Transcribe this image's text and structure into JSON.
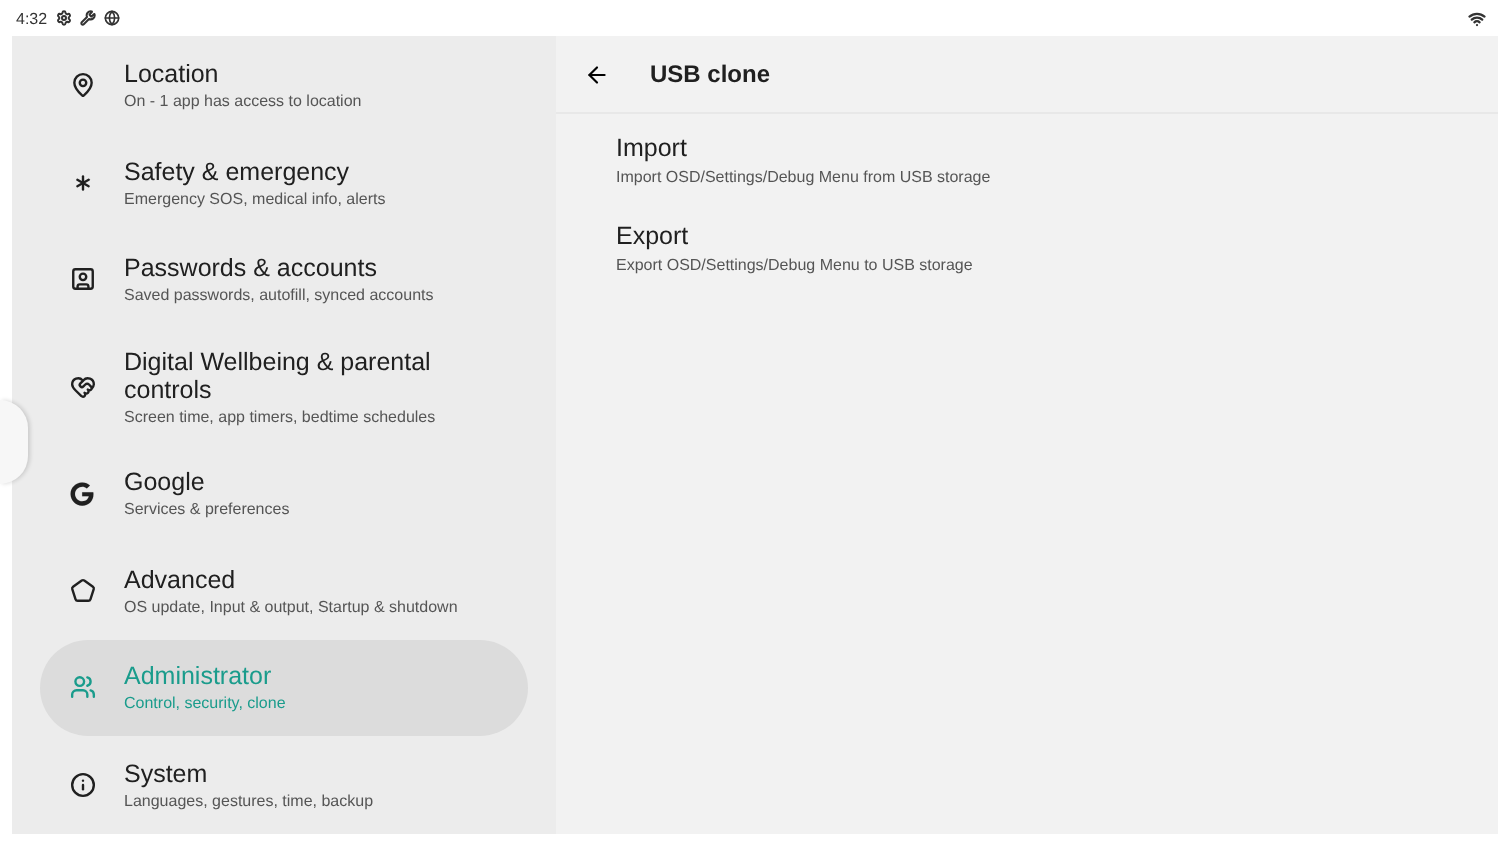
{
  "status_bar": {
    "time": "4:32"
  },
  "sidebar": {
    "items": [
      {
        "title": "Location",
        "subtitle": "On - 1 app has access to location",
        "selected": false
      },
      {
        "title": "Safety & emergency",
        "subtitle": "Emergency SOS, medical info, alerts",
        "selected": false
      },
      {
        "title": "Passwords & accounts",
        "subtitle": "Saved passwords, autofill, synced accounts",
        "selected": false
      },
      {
        "title": "Digital Wellbeing & parental controls",
        "subtitle": "Screen time, app timers, bedtime schedules",
        "selected": false
      },
      {
        "title": "Google",
        "subtitle": "Services & preferences",
        "selected": false
      },
      {
        "title": "Advanced",
        "subtitle": "OS update, Input & output, Startup & shutdown",
        "selected": false
      },
      {
        "title": "Administrator",
        "subtitle": "Control, security, clone",
        "selected": true
      },
      {
        "title": "System",
        "subtitle": "Languages, gestures, time, backup",
        "selected": false
      }
    ]
  },
  "detail": {
    "title": "USB clone",
    "items": [
      {
        "title": "Import",
        "subtitle": "Import OSD/Settings/Debug Menu from USB storage"
      },
      {
        "title": "Export",
        "subtitle": "Export OSD/Settings/Debug Menu to USB storage"
      }
    ]
  }
}
